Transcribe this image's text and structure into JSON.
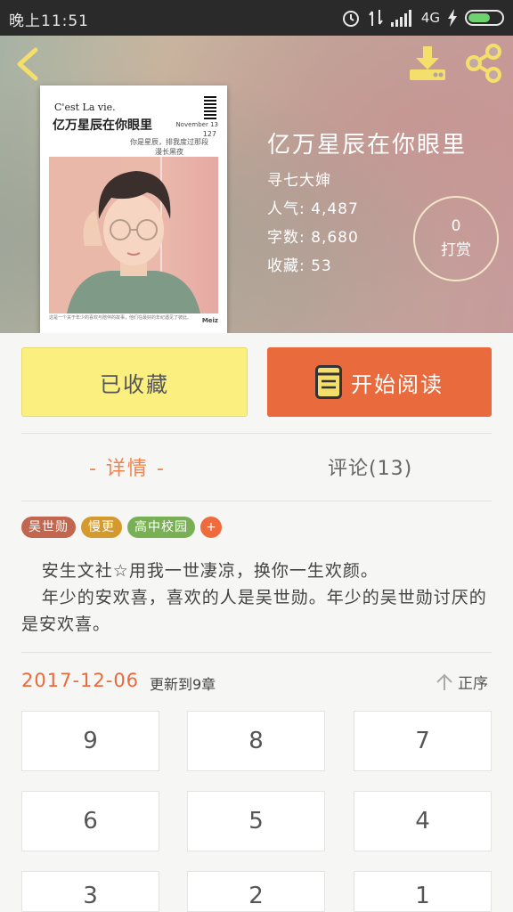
{
  "status_bar": {
    "time": "晚上11:51",
    "network": "4G"
  },
  "book": {
    "title": "亿万星辰在你眼里",
    "author": "寻七大婶",
    "popularity_label": "人气:",
    "popularity": "4,487",
    "words_label": "字数:",
    "words": "8,680",
    "favorites_label": "收藏:",
    "favorites": "53"
  },
  "cover": {
    "top_text": "C'est La vie.",
    "title": "亿万星辰在你眼里",
    "date": "November 13",
    "number": "127",
    "subtitle": "你是星辰，排我度过那段漫长黑夜",
    "footer_text": "这是一个关于年少的喜欢与陪伴的故事，他们在最好的年纪遇见了彼此。",
    "brand": "Meiz"
  },
  "reward": {
    "count": "0",
    "label": "打赏"
  },
  "actions": {
    "collected": "已收藏",
    "start_reading": "开始阅读"
  },
  "tabs": {
    "detail": "- 详情 -",
    "comments": "评论(13)"
  },
  "tags": [
    {
      "label": "吴世勋",
      "color": "#c2664f"
    },
    {
      "label": "慢更",
      "color": "#d49a2e"
    },
    {
      "label": "高中校园",
      "color": "#79b055"
    }
  ],
  "tag_add": "+",
  "description": {
    "line1": "安生文社☆用我一世凄凉，换你一生欢颜。",
    "line2": "年少的安欢喜，喜欢的人是吴世勋。年少的吴世勋讨厌的是安欢喜。"
  },
  "update": {
    "date": "2017-12-06",
    "text": "更新到9章",
    "sort_label": "正序"
  },
  "chapters": [
    "9",
    "8",
    "7",
    "6",
    "5",
    "4",
    "3",
    "2",
    "1"
  ],
  "colors": {
    "accent": "#e96a3c",
    "collected_bg": "#fbf07f",
    "icon_yellow": "#f3df6a"
  }
}
